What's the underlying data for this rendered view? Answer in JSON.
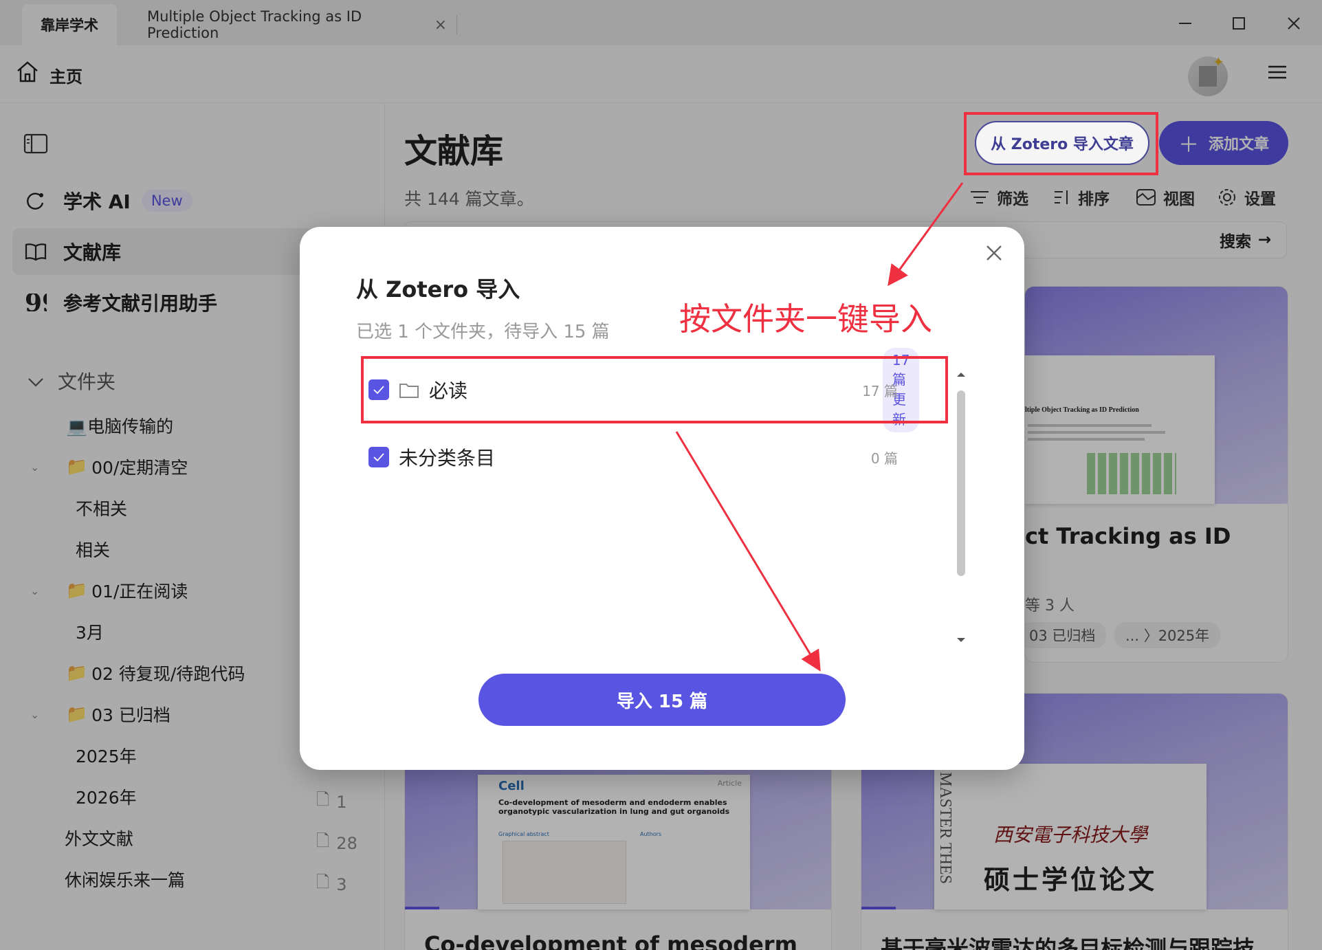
{
  "tabs": [
    {
      "label": "靠岸学术"
    },
    {
      "label": "Multiple Object Tracking as ID Prediction",
      "close": "×"
    }
  ],
  "header": {
    "home_label": "主页"
  },
  "sidebar": {
    "nav": [
      {
        "label": "学术 AI",
        "badge": "New"
      },
      {
        "label": "文献库"
      },
      {
        "label": "参考文献引用助手"
      }
    ],
    "folders_label": "文件夹",
    "tree": [
      {
        "label": "💻电脑传输的"
      },
      {
        "label": "00/定期清空"
      },
      {
        "label": "不相关"
      },
      {
        "label": "相关"
      },
      {
        "label": "01/正在阅读"
      },
      {
        "label": "3月"
      },
      {
        "label": "02 待复现/待跑代码"
      },
      {
        "label": "03 已归档"
      },
      {
        "label": "2025年"
      },
      {
        "label": "2026年",
        "count": "1"
      },
      {
        "label": "外文文献",
        "count": "28"
      },
      {
        "label": "休闲娱乐来一篇",
        "count": "3"
      }
    ]
  },
  "main": {
    "title": "文献库",
    "subtitle": "共 144 篇文章。",
    "zotero_button": "从 Zotero 导入文章",
    "add_button": "添加文章",
    "toolbar": [
      "筛选",
      "排序",
      "视图",
      "设置"
    ],
    "search_label": "搜索",
    "cards": [
      {
        "title": "ct Tracking as ID",
        "authors": "等 3 人",
        "chips": [
          "03 已归档",
          "... 〉2025年"
        ],
        "thumb_title": "ltiple Object Tracking as ID Prediction"
      },
      {
        "title": "Co-development of mesoderm",
        "thumb_brand": "Cell",
        "thumb_type": "Article",
        "thumb_title": "Co-development of mesoderm and endoderm enables organotypic vascularization in lung and gut organoids",
        "thumb_section": "Graphical abstract",
        "thumb_authors_label": "Authors"
      },
      {
        "title": "基于毫米波雷达的多目标检测与跟踪技",
        "thumb_university": "西安電子科技大學",
        "thumb_heading": "硕士学位论文",
        "thumb_side": "MASTER THES"
      }
    ]
  },
  "modal": {
    "title": "从 Zotero 导入",
    "subtitle": "已选 1 个文件夹，待导入 15 篇",
    "rows": [
      {
        "label": "必读",
        "update": "17 篇更新",
        "count": "17 篇",
        "checked": true
      },
      {
        "label": "未分类条目",
        "count": "0 篇",
        "checked": true
      }
    ],
    "import_button": "导入 15 篇"
  },
  "annotation": {
    "text": "按文件夹一键导入",
    "color": "#ee3040"
  },
  "colors": {
    "accent": "#5a54e2",
    "annotation_red": "#ee3040"
  }
}
